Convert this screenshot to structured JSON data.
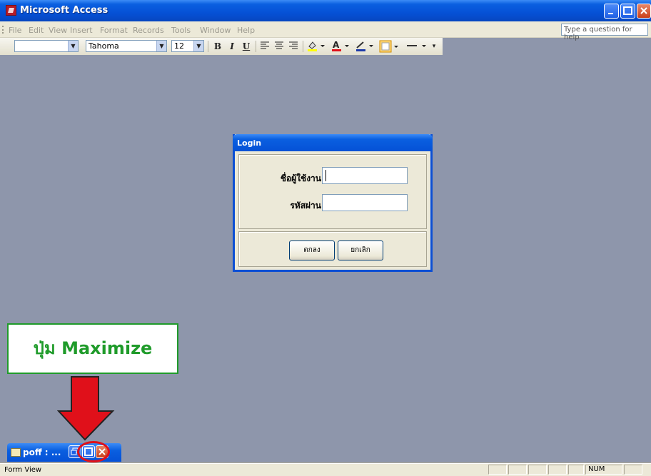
{
  "window": {
    "title": "Microsoft Access"
  },
  "menu": {
    "items": [
      "File",
      "Edit",
      "View",
      "Insert",
      "Format",
      "Records",
      "Tools",
      "Window",
      "Help"
    ]
  },
  "help": {
    "placeholder": "Type a question for help"
  },
  "toolbar": {
    "object_combo": "",
    "font_name": "Tahoma",
    "font_size": "12",
    "bold": "B",
    "italic": "I",
    "underline": "U"
  },
  "dialog": {
    "title": "Login",
    "username_label": "ชื่อผู้ใช้งาน",
    "password_label": "รหัสผ่าน",
    "username_value": "",
    "password_value": "",
    "ok_label": "ตกลง",
    "cancel_label": "ยกเลิก"
  },
  "callout": {
    "text": "ปุ่ม Maximize",
    "color": "#1f9b2a",
    "arrow_color": "#e0101a"
  },
  "minimized": {
    "title": "poff : ..."
  },
  "status": {
    "text": "Form View",
    "num": "NUM"
  },
  "colors": {
    "desktop": "#8e96ab",
    "titlebar": "#0551d6",
    "dialog_bg": "#ece9d8"
  }
}
